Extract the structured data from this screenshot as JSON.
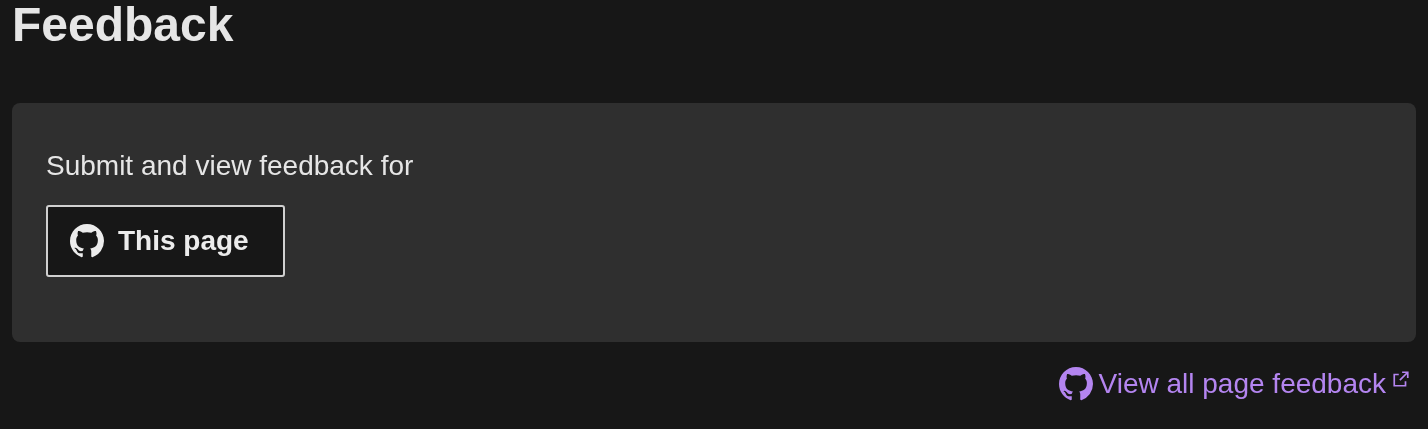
{
  "heading": "Feedback",
  "card": {
    "text": "Submit and view feedback for",
    "button": {
      "label": "This page"
    }
  },
  "link": {
    "label": "View all page feedback"
  }
}
